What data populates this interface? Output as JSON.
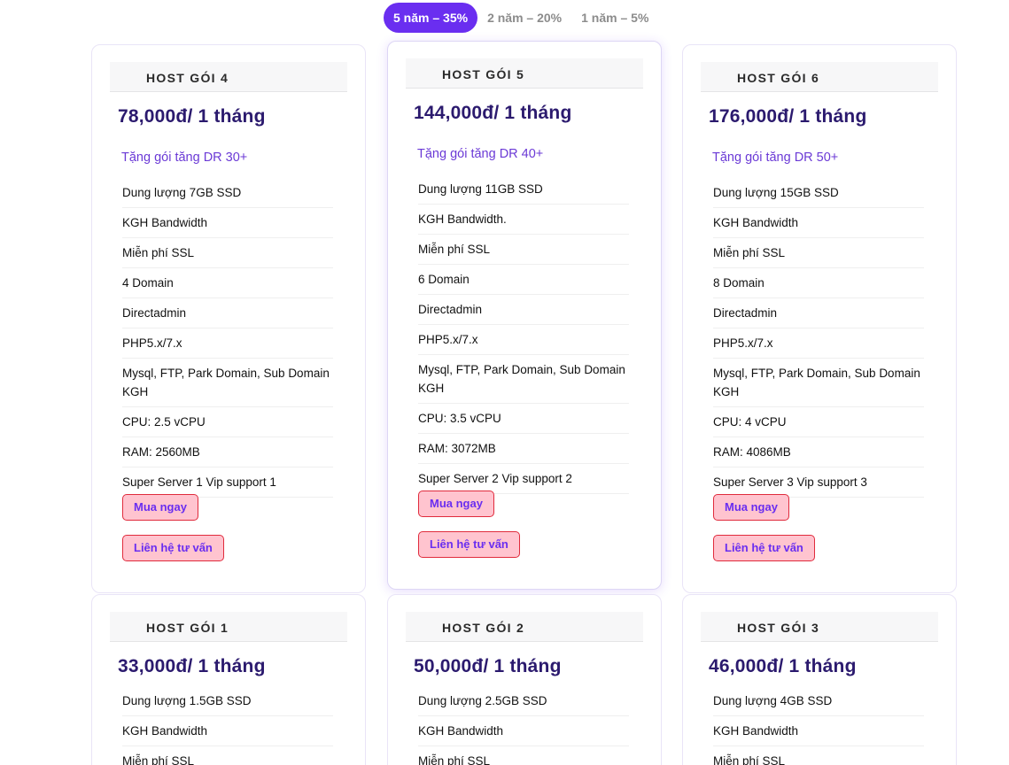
{
  "tabs": [
    {
      "label": "5 năm – 35%",
      "active": true
    },
    {
      "label": "2 năm – 20%",
      "active": false
    },
    {
      "label": "1 năm – 5%",
      "active": false
    }
  ],
  "cards": [
    {
      "name": "HOST GÓI 4",
      "price": "78,000đ/ 1 tháng",
      "bonus": "Tặng gói tăng DR 30+",
      "features": [
        "Dung lượng 7GB SSD",
        "KGH Bandwidth",
        "Miễn phí SSL",
        "4 Domain",
        "Directadmin",
        "PHP5.x/7.x",
        "Mysql, FTP, Park Domain, Sub Domain KGH",
        "CPU: 2.5 vCPU",
        "RAM: 2560MB",
        "Super Server 1 Vip support 1"
      ],
      "buy_label": "Mua ngay",
      "contact_label": "Liên hệ tư vấn"
    },
    {
      "name": "HOST GÓI 5",
      "price": "144,000đ/ 1 tháng",
      "bonus": "Tặng gói tăng DR 40+",
      "features": [
        "Dung lượng 11GB SSD",
        "KGH Bandwidth.",
        "Miễn phí SSL",
        "6 Domain",
        "Directadmin",
        "PHP5.x/7.x",
        "Mysql, FTP, Park Domain, Sub Domain KGH",
        "CPU: 3.5 vCPU",
        "RAM: 3072MB",
        "Super Server 2 Vip support 2"
      ],
      "buy_label": "Mua ngay",
      "contact_label": "Liên hệ tư vấn"
    },
    {
      "name": "HOST GÓI 6",
      "price": "176,000đ/ 1 tháng",
      "bonus": "Tặng gói tăng DR 50+",
      "features": [
        "Dung lượng 15GB SSD",
        "KGH Bandwidth",
        "Miễn phí SSL",
        "8 Domain",
        "Directadmin",
        "PHP5.x/7.x",
        "Mysql, FTP, Park Domain, Sub Domain KGH",
        "CPU: 4 vCPU",
        "RAM: 4086MB",
        "Super Server 3 Vip support 3"
      ],
      "buy_label": "Mua ngay",
      "contact_label": "Liên hệ tư vấn"
    },
    {
      "name": "HOST GÓI 1",
      "price": "33,000đ/ 1 tháng",
      "features": [
        "Dung lượng 1.5GB SSD",
        "KGH Bandwidth",
        "Miễn phí SSL"
      ]
    },
    {
      "name": "HOST GÓI 2",
      "price": "50,000đ/ 1 tháng",
      "features": [
        "Dung lượng 2.5GB SSD",
        "KGH Bandwidth",
        "Miễn phí SSL"
      ]
    },
    {
      "name": "HOST GÓI 3",
      "price": "46,000đ/ 1 tháng",
      "features": [
        "Dung lượng 4GB SSD",
        "KGH Bandwidth",
        "Miễn phí SSL"
      ]
    }
  ]
}
